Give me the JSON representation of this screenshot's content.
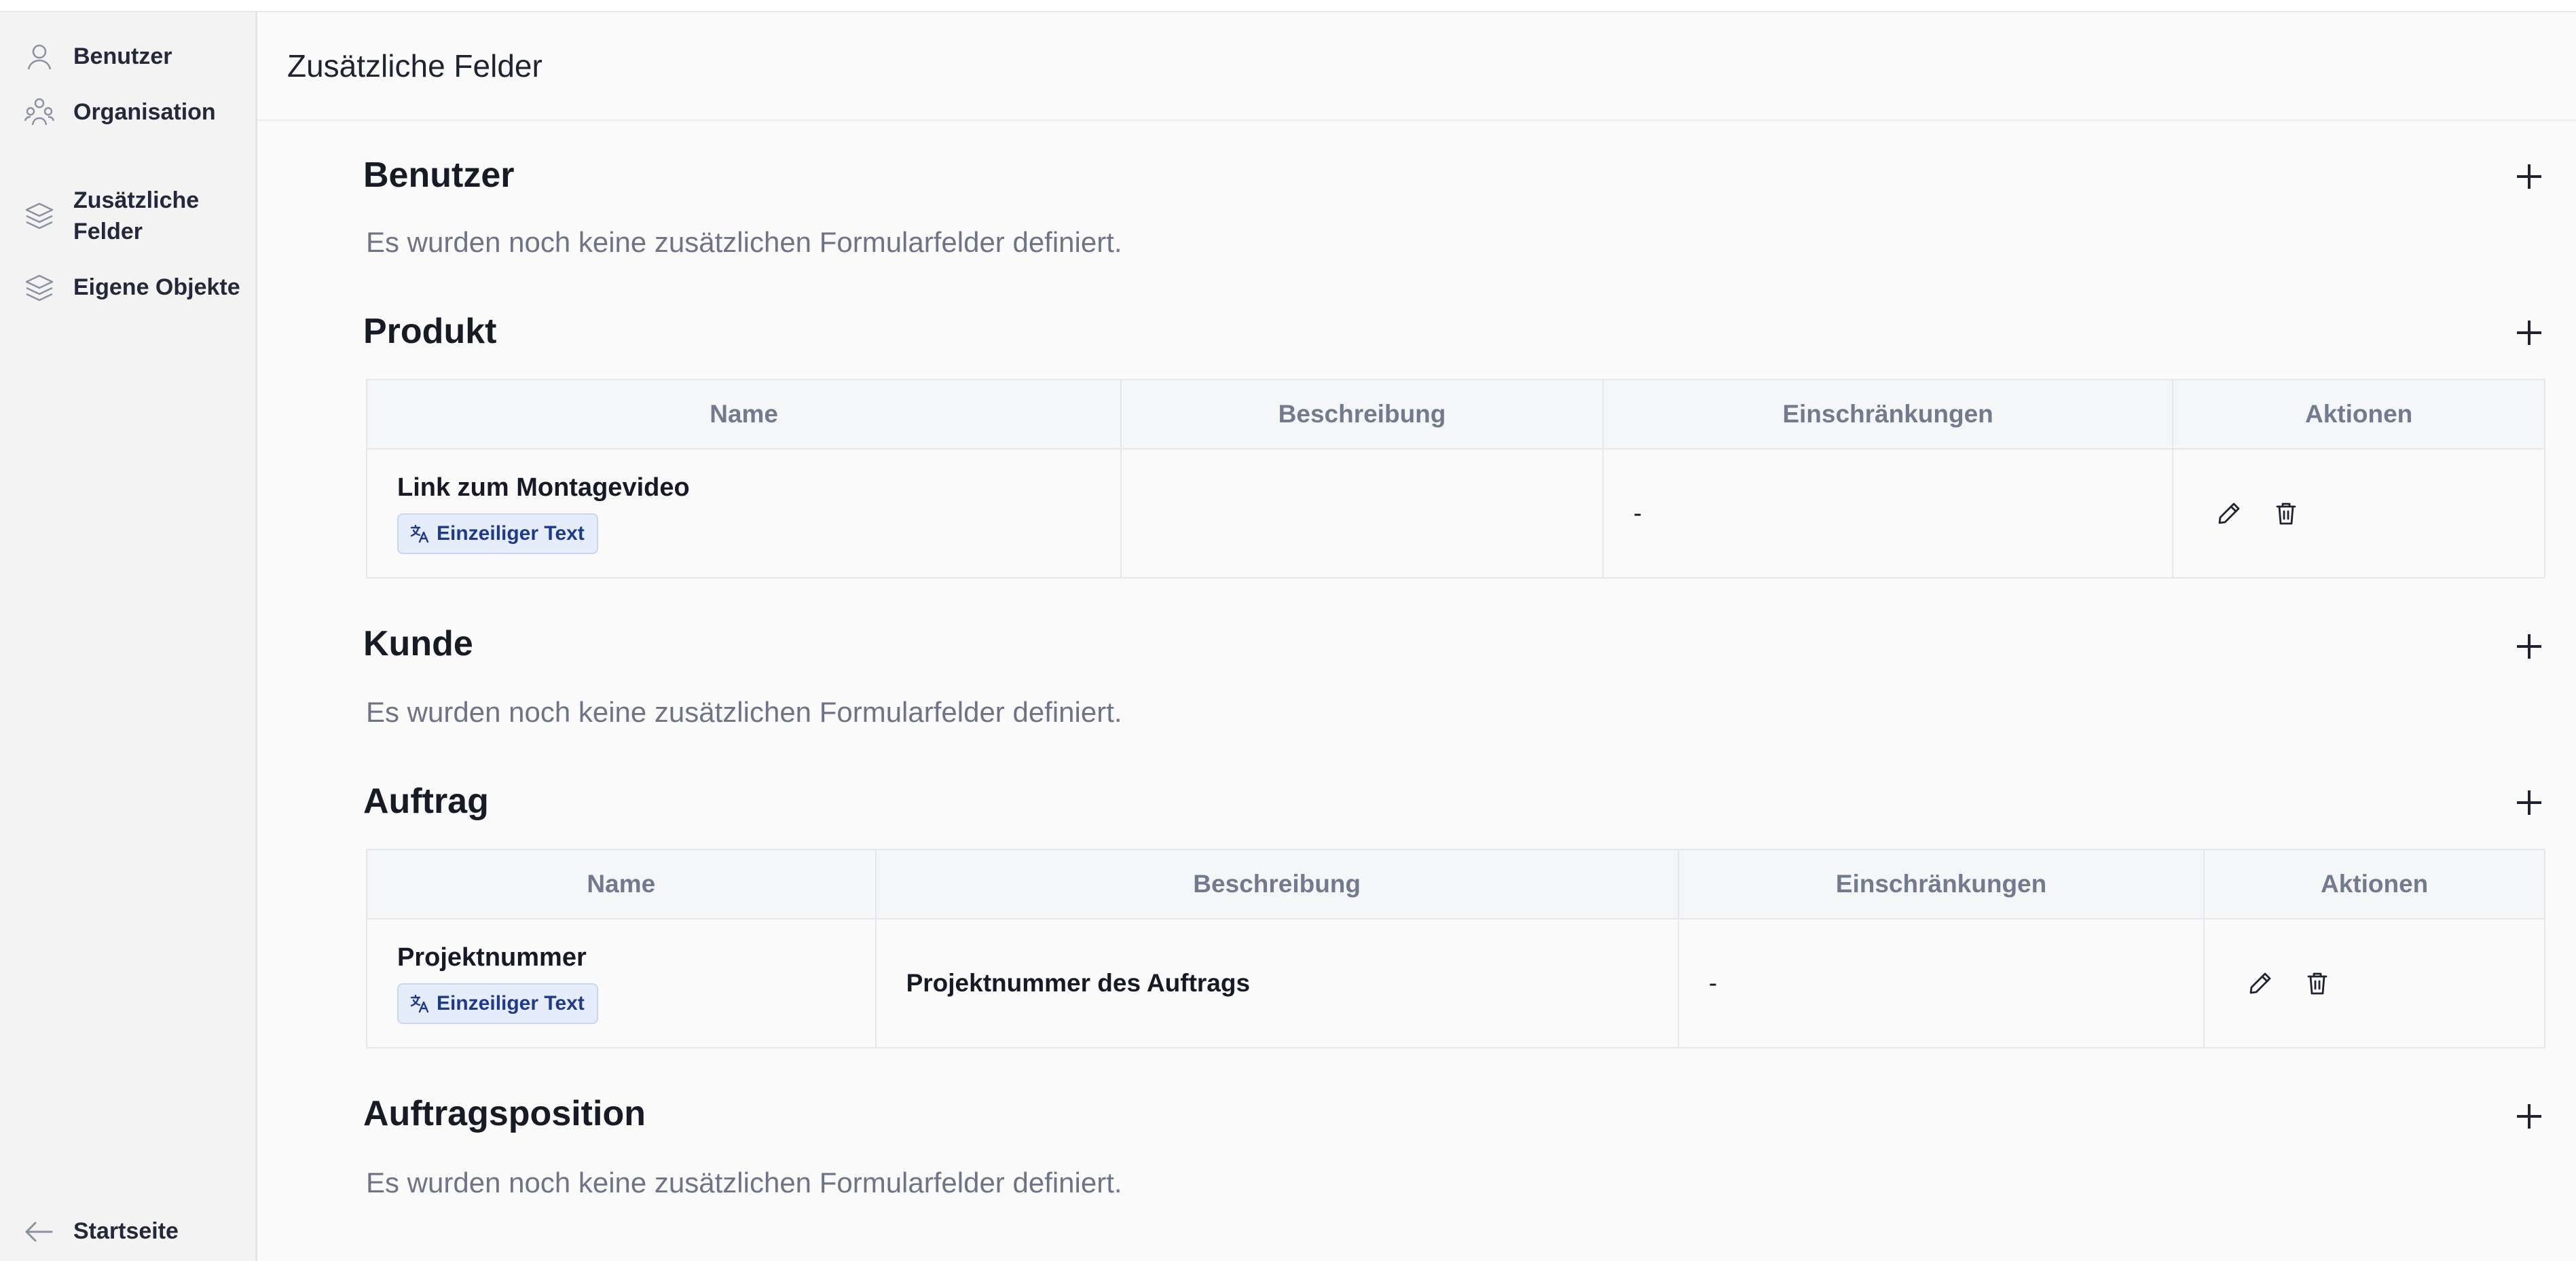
{
  "sidebar": {
    "items": [
      {
        "label": "Benutzer",
        "icon": "user-icon"
      },
      {
        "label": "Organisation",
        "icon": "organization-icon"
      },
      {
        "label": "Zusätzliche\nFelder",
        "icon": "layers-icon"
      },
      {
        "label": "Eigene Objekte",
        "icon": "layers-icon"
      }
    ],
    "back": {
      "label": "Startseite",
      "icon": "arrow-left-icon"
    }
  },
  "page": {
    "title": "Zusätzliche Felder"
  },
  "table_headers": {
    "name": "Name",
    "description": "Beschreibung",
    "constraints": "Einschränkungen",
    "actions": "Aktionen"
  },
  "sections": {
    "benutzer": {
      "title": "Benutzer",
      "empty": "Es wurden noch keine zusätzlichen Formularfelder definiert."
    },
    "produkt": {
      "title": "Produkt",
      "rows": [
        {
          "name": "Link zum Montagevideo",
          "type": "Einzeiliger Text",
          "description": "",
          "constraints": "-"
        }
      ]
    },
    "kunde": {
      "title": "Kunde",
      "empty": "Es wurden noch keine zusätzlichen Formularfelder definiert."
    },
    "auftrag": {
      "title": "Auftrag",
      "rows": [
        {
          "name": "Projektnummer",
          "type": "Einzeiliger Text",
          "description": "Projektnummer des Auftrags",
          "constraints": "-"
        }
      ]
    },
    "auftragsposition": {
      "title": "Auftragsposition",
      "empty": "Es wurden noch keine zusätzlichen Formularfelder definiert."
    }
  },
  "colors": {
    "accent": "#1f3a8a",
    "badge_bg": "#e5edfb",
    "muted_text": "#6e7385"
  }
}
